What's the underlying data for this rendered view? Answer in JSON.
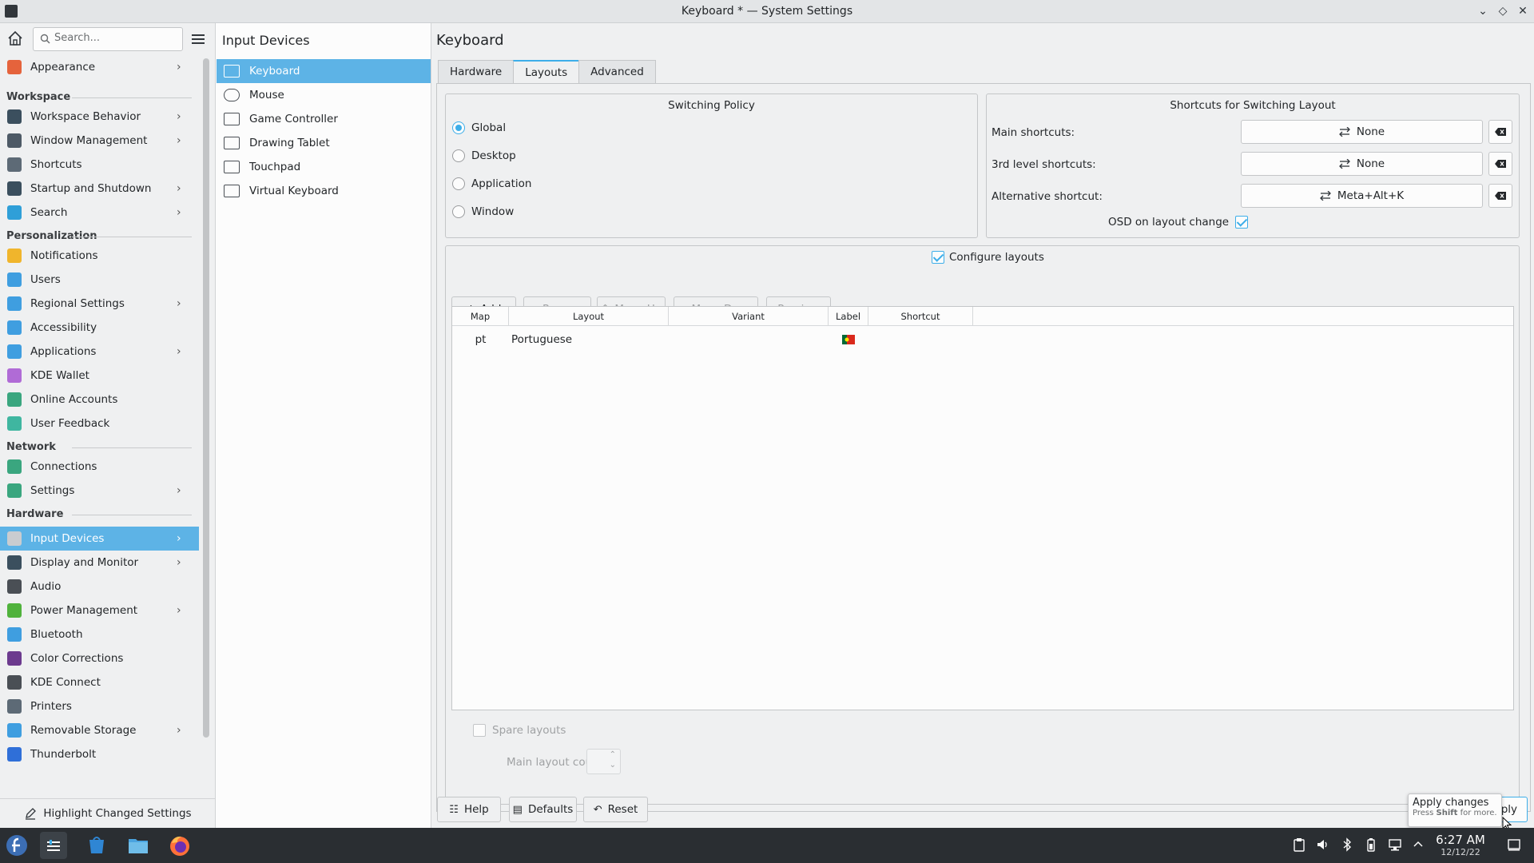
{
  "window": {
    "title": "Keyboard * — System Settings"
  },
  "search": {
    "placeholder": "Search..."
  },
  "sidebar": {
    "items": [
      {
        "label": "Appearance",
        "chevron": true,
        "icon": "appearance-icon",
        "color": "#e5633c"
      },
      {
        "section": "Workspace"
      },
      {
        "label": "Workspace Behavior",
        "chevron": true,
        "icon": "workspace-behavior-icon",
        "color": "#3b4f5e"
      },
      {
        "label": "Window Management",
        "chevron": true,
        "icon": "window-management-icon",
        "color": "#4e5a66"
      },
      {
        "label": "Shortcuts",
        "chevron": false,
        "icon": "keyboard-icon",
        "color": "#5d6a76"
      },
      {
        "label": "Startup and Shutdown",
        "chevron": true,
        "icon": "startup-icon",
        "color": "#3b4f5e"
      },
      {
        "label": "Search",
        "chevron": true,
        "icon": "search-icon",
        "color": "#2f9fd8"
      },
      {
        "section": "Personalization"
      },
      {
        "label": "Notifications",
        "chevron": false,
        "icon": "bell-icon",
        "color": "#f0b52c"
      },
      {
        "label": "Users",
        "chevron": false,
        "icon": "users-icon",
        "color": "#3f9ee0"
      },
      {
        "label": "Regional Settings",
        "chevron": true,
        "icon": "regional-icon",
        "color": "#3f9ee0"
      },
      {
        "label": "Accessibility",
        "chevron": false,
        "icon": "accessibility-icon",
        "color": "#3f9ee0"
      },
      {
        "label": "Applications",
        "chevron": true,
        "icon": "applications-icon",
        "color": "#3f9ee0"
      },
      {
        "label": "KDE Wallet",
        "chevron": false,
        "icon": "wallet-icon",
        "color": "#b06bd6"
      },
      {
        "label": "Online Accounts",
        "chevron": false,
        "icon": "online-accounts-icon",
        "color": "#3aa67f"
      },
      {
        "label": "User Feedback",
        "chevron": false,
        "icon": "feedback-icon",
        "color": "#3fb6a0"
      },
      {
        "section": "Network"
      },
      {
        "label": "Connections",
        "chevron": false,
        "icon": "globe-icon",
        "color": "#3aa67f"
      },
      {
        "label": "Settings",
        "chevron": true,
        "icon": "network-settings-icon",
        "color": "#3aa67f"
      },
      {
        "section": "Hardware"
      },
      {
        "label": "Input Devices",
        "chevron": true,
        "icon": "mouse-icon",
        "color": "#c9ccd0",
        "selected": true
      },
      {
        "label": "Display and Monitor",
        "chevron": true,
        "icon": "monitor-icon",
        "color": "#3b4f5e"
      },
      {
        "label": "Audio",
        "chevron": false,
        "icon": "audio-icon",
        "color": "#4a4f55"
      },
      {
        "label": "Power Management",
        "chevron": true,
        "icon": "power-icon",
        "color": "#50b23c"
      },
      {
        "label": "Bluetooth",
        "chevron": false,
        "icon": "bluetooth-icon",
        "color": "#3f9ee0"
      },
      {
        "label": "Color Corrections",
        "chevron": false,
        "icon": "color-corrections-icon",
        "color": "#6c3a8e"
      },
      {
        "label": "KDE Connect",
        "chevron": false,
        "icon": "phone-icon",
        "color": "#4a4f55"
      },
      {
        "label": "Printers",
        "chevron": false,
        "icon": "printer-icon",
        "color": "#5d6a76"
      },
      {
        "label": "Removable Storage",
        "chevron": true,
        "icon": "usb-icon",
        "color": "#3f9ee0"
      },
      {
        "label": "Thunderbolt",
        "chevron": false,
        "icon": "thunderbolt-icon",
        "color": "#2f6fd8"
      }
    ],
    "highlight_label": "Highlight Changed Settings"
  },
  "subpanel": {
    "title": "Input Devices",
    "items": [
      {
        "label": "Keyboard",
        "icon": "keyboard-icon",
        "selected": true
      },
      {
        "label": "Mouse",
        "icon": "mouse-icon"
      },
      {
        "label": "Game Controller",
        "icon": "gamepad-icon"
      },
      {
        "label": "Drawing Tablet",
        "icon": "tablet-icon"
      },
      {
        "label": "Touchpad",
        "icon": "touchpad-icon"
      },
      {
        "label": "Virtual Keyboard",
        "icon": "virtual-keyboard-icon"
      }
    ]
  },
  "content": {
    "title": "Keyboard",
    "tabs": [
      {
        "label": "Hardware"
      },
      {
        "label": "Layouts",
        "active": true
      },
      {
        "label": "Advanced"
      }
    ],
    "switching_policy": {
      "title": "Switching Policy",
      "options": [
        {
          "label": "Global",
          "selected": true
        },
        {
          "label": "Desktop"
        },
        {
          "label": "Application"
        },
        {
          "label": "Window"
        }
      ]
    },
    "shortcuts": {
      "title": "Shortcuts for Switching Layout",
      "rows": [
        {
          "label": "Main shortcuts:",
          "value": "None"
        },
        {
          "label": "3rd level shortcuts:",
          "value": "None"
        },
        {
          "label": "Alternative shortcut:",
          "value": "Meta+Alt+K"
        }
      ],
      "osd_label": "OSD on layout change",
      "osd_checked": true
    },
    "configure": {
      "label": "Configure layouts",
      "checked": true
    },
    "toolbar": {
      "add": "Add",
      "remove": "Remove",
      "move_up": "Move Up",
      "move_down": "Move Down",
      "preview": "Preview"
    },
    "table": {
      "columns": [
        "Map",
        "Layout",
        "Variant",
        "Label",
        "Shortcut"
      ],
      "rows": [
        {
          "map": "pt",
          "layout": "Portuguese",
          "variant": "",
          "label_icon": "portugal-flag-icon",
          "shortcut": ""
        }
      ]
    },
    "spare_layouts": {
      "label": "Spare layouts",
      "checked": false
    },
    "main_layout_count": {
      "label": "Main layout count:",
      "value": ""
    }
  },
  "footer": {
    "help": "Help",
    "defaults": "Defaults",
    "reset": "Reset",
    "apply_visible": "ply",
    "tooltip_title": "Apply changes",
    "tooltip_hint_pre": "Press ",
    "tooltip_hint_key": "Shift",
    "tooltip_hint_post": " for more."
  },
  "taskbar": {
    "time": "6:27 AM",
    "date": "12/12/22",
    "tray": [
      "clipboard-icon",
      "volume-icon",
      "bluetooth-icon",
      "battery-icon",
      "network-icon",
      "expand-tray-icon",
      "show-desktop-icon"
    ]
  }
}
